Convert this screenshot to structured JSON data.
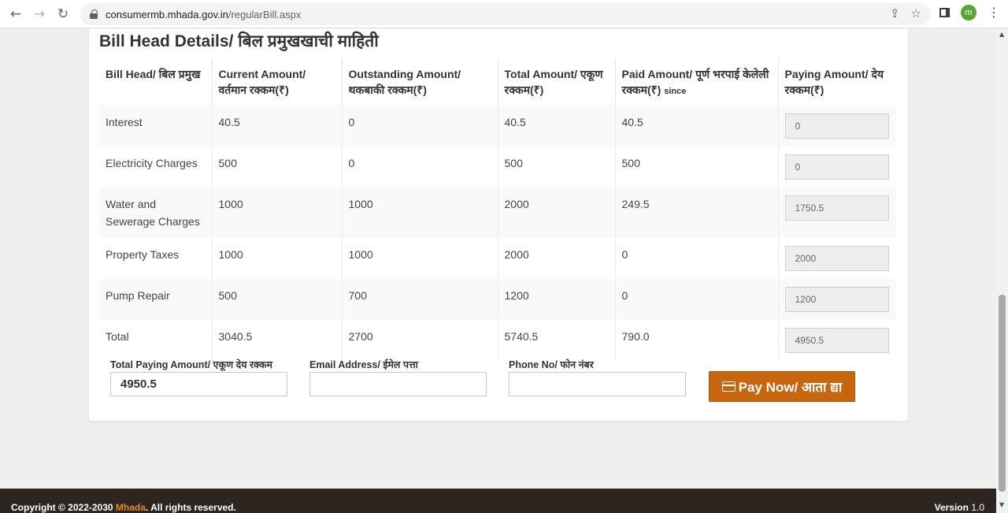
{
  "browser": {
    "url_domain": "consumermb.mhada.gov.in",
    "url_path": "/regularBill.aspx",
    "avatar_letter": "m"
  },
  "section_title": "Bill Head Details/ बिल प्रमुखखाची माहिती",
  "table": {
    "headers": {
      "bill_head": "Bill Head/ बिल प्रमुख",
      "current": "Current Amount/ वर्तमान रक्कम(₹)",
      "outstanding": "Outstanding Amount/ थकबाकी रक्कम(₹)",
      "total": "Total Amount/ एकूण रक्कम(₹)",
      "paid": "Paid Amount/ पूर्ण भरपाई केलेली रक्कम(₹)",
      "paid_since": "since",
      "paying": "Paying Amount/ देय रक्कम(₹)"
    },
    "rows": [
      {
        "head": "Interest",
        "current": "40.5",
        "outstanding": "0",
        "total": "40.5",
        "paid": "40.5",
        "paying": "0"
      },
      {
        "head": "Electricity Charges",
        "current": "500",
        "outstanding": "0",
        "total": "500",
        "paid": "500",
        "paying": "0"
      },
      {
        "head": "Water and Sewerage Charges",
        "current": "1000",
        "outstanding": "1000",
        "total": "2000",
        "paid": "249.5",
        "paying": "1750.5"
      },
      {
        "head": "Property Taxes",
        "current": "1000",
        "outstanding": "1000",
        "total": "2000",
        "paid": "0",
        "paying": "2000"
      },
      {
        "head": "Pump Repair",
        "current": "500",
        "outstanding": "700",
        "total": "1200",
        "paid": "0",
        "paying": "1200"
      },
      {
        "head": "Total",
        "current": "3040.5",
        "outstanding": "2700",
        "total": "5740.5",
        "paid": "790.0",
        "paying": "4950.5"
      }
    ]
  },
  "form": {
    "total_paying_label": "Total Paying Amount/ एकूण देय रक्कम",
    "total_paying_value": "4950.5",
    "email_label": "Email Address/ ईमेल पत्ता",
    "email_value": "",
    "phone_label": "Phone No/ फोन नंबर",
    "phone_value": "",
    "pay_button": "Pay Now/ आता द्या"
  },
  "footer": {
    "copyright_prefix": "Copyright © 2022-2030 ",
    "brand": "Mhada",
    "copyright_suffix": ". All rights reserved.",
    "version_label": "Version",
    "version_value": "1.0"
  },
  "colors": {
    "accent": "#c8650f",
    "footer_bg": "#2c2520",
    "brand": "#e58a2a"
  }
}
